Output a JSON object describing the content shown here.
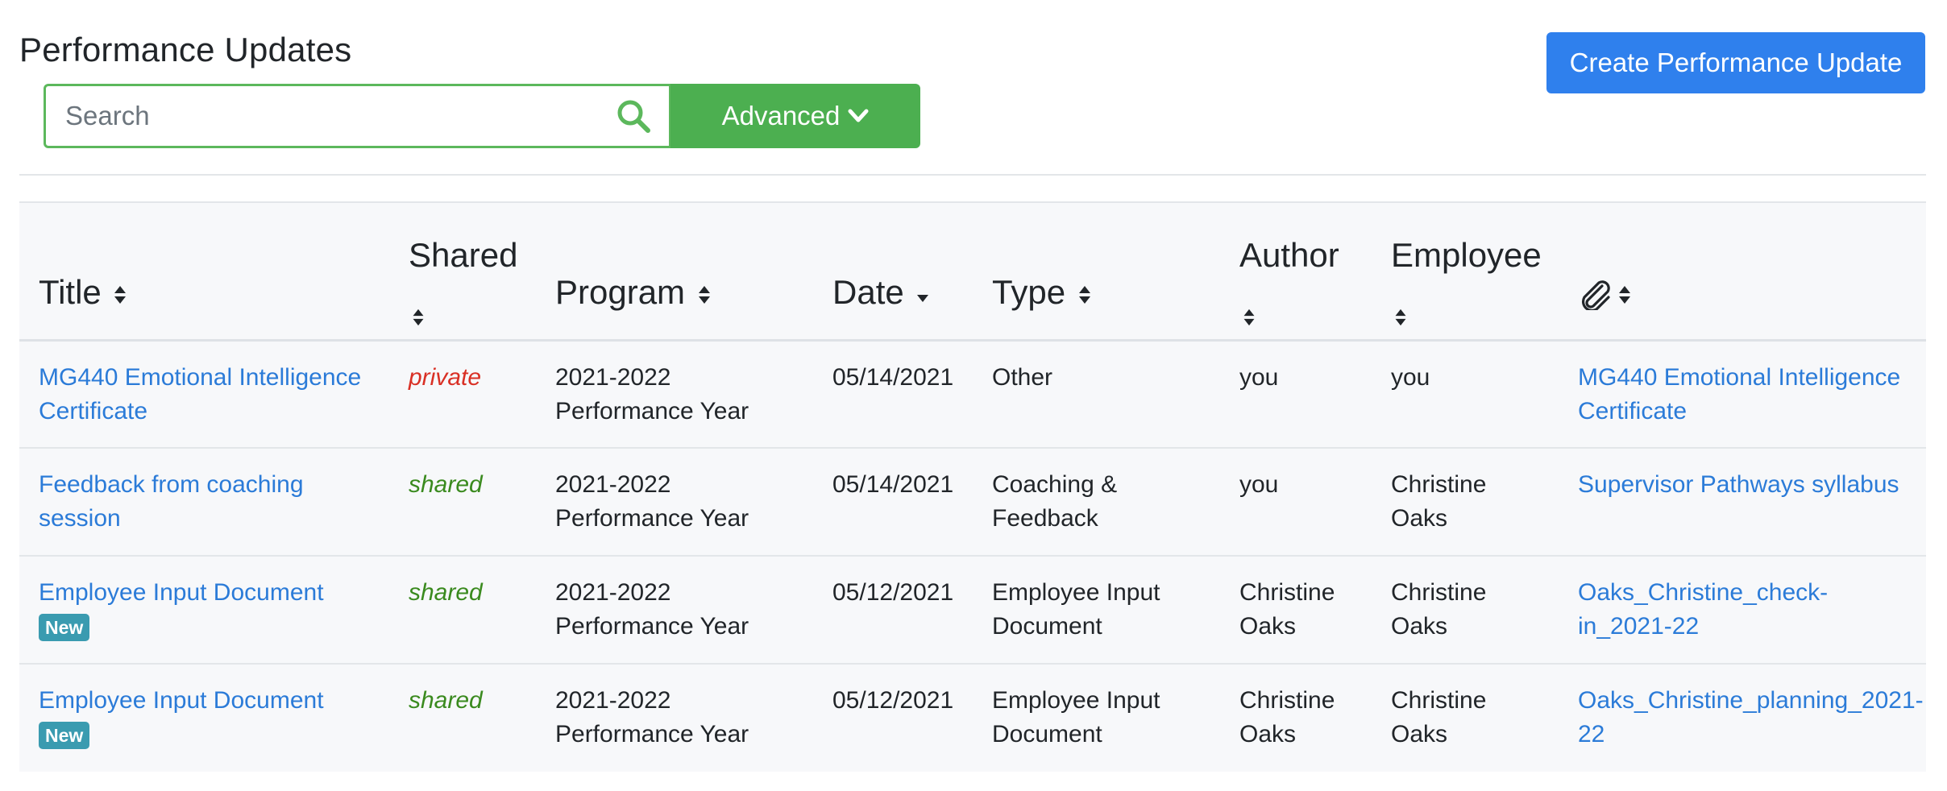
{
  "header": {
    "title": "Performance Updates",
    "create_label": "Create Performance Update"
  },
  "search": {
    "placeholder": "Search",
    "value": "",
    "icon": "search-icon",
    "advanced_label": "Advanced",
    "advanced_icon": "chevron-down-icon"
  },
  "colors": {
    "primary": "#2f80ed",
    "success": "#4caf50",
    "link": "#2b7bd8",
    "private": "#d93025",
    "shared": "#3a8a1e",
    "badge": "#3a9bb0"
  },
  "table": {
    "columns": {
      "title": "Title",
      "shared": "Shared",
      "program": "Program",
      "date": "Date",
      "type": "Type",
      "author": "Author",
      "employee": "Employee",
      "attachment_icon": "paperclip-icon"
    },
    "rows": [
      {
        "title": "MG440 Emotional Intelligence Certificate",
        "badge": "",
        "shared": "private",
        "program": "2021-2022 Performance Year",
        "date": "05/14/2021",
        "type": "Other",
        "author": "you",
        "employee": "you",
        "attachment": "MG440 Emotional Intelligence Certificate"
      },
      {
        "title": "Feedback from coaching session",
        "badge": "",
        "shared": "shared",
        "program": "2021-2022 Performance Year",
        "date": "05/14/2021",
        "type": "Coaching & Feedback",
        "author": "you",
        "employee": "Christine Oaks",
        "attachment": "Supervisor Pathways syllabus"
      },
      {
        "title": "Employee Input Document",
        "badge": "New",
        "shared": "shared",
        "program": "2021-2022 Performance Year",
        "date": "05/12/2021",
        "type": "Employee Input Document",
        "author": "Christine Oaks",
        "employee": "Christine Oaks",
        "attachment": "Oaks_Christine_check-in_2021-22"
      },
      {
        "title": "Employee Input Document",
        "badge": "New",
        "shared": "shared",
        "program": "2021-2022 Performance Year",
        "date": "05/12/2021",
        "type": "Employee Input Document",
        "author": "Christine Oaks",
        "employee": "Christine Oaks",
        "attachment": "Oaks_Christine_planning_2021-22"
      }
    ]
  }
}
